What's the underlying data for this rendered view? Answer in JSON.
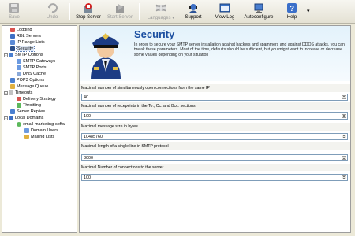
{
  "toolbar": {
    "buttons": [
      {
        "label": "Save",
        "icon": "save-icon",
        "enabled": false
      },
      {
        "label": "Undo",
        "icon": "undo-icon",
        "enabled": false
      },
      {
        "label": "Stop Server",
        "icon": "stop-server-icon",
        "enabled": true
      },
      {
        "label": "Start Server",
        "icon": "start-server-icon",
        "enabled": false
      },
      {
        "label": "Languages",
        "icon": "flag-icon",
        "enabled": false
      },
      {
        "label": "Support",
        "icon": "support-icon",
        "enabled": true
      },
      {
        "label": "View Log",
        "icon": "view-log-icon",
        "enabled": true
      },
      {
        "label": "Autoconfigure",
        "icon": "autoconfigure-icon",
        "enabled": true
      },
      {
        "label": "Help",
        "icon": "help-icon",
        "enabled": true
      }
    ]
  },
  "tree": {
    "items": [
      {
        "label": "Logging",
        "level": 1
      },
      {
        "label": "RBL Servers",
        "level": 1
      },
      {
        "label": "IP Range Lists",
        "level": 1
      },
      {
        "label": "Security",
        "level": 1,
        "selected": true
      },
      {
        "label": "SMTP Options",
        "level": 0
      },
      {
        "label": "SMTP Gateways",
        "level": 2
      },
      {
        "label": "SMTP Ports",
        "level": 2
      },
      {
        "label": "DNS Cache",
        "level": 2
      },
      {
        "label": "POP3 Options",
        "level": 1
      },
      {
        "label": "Message Queue",
        "level": 1
      },
      {
        "label": "Timeouts",
        "level": 0
      },
      {
        "label": "Delivery Strategy",
        "level": 2
      },
      {
        "label": "Throttling",
        "level": 2
      },
      {
        "label": "Server Replies",
        "level": 1
      },
      {
        "label": "Local Domains",
        "level": 0
      },
      {
        "label": "email-marketing-softw",
        "level": 2
      },
      {
        "label": "Domain Users",
        "level": 3
      },
      {
        "label": "Mailing Lists",
        "level": 3
      }
    ]
  },
  "header": {
    "title": "Security",
    "description": "In order to secure your SMTP server installation against hackers and spammers and against DDOS attacks, you can tweak these parameters. Most of the time, defaults should be sufficient, but you might want to increase or decrease some values depending on your situation"
  },
  "fields": [
    {
      "label": "Maximal number of simultaneously open connections from the same IP",
      "value": "40"
    },
    {
      "label": "Maximal number of recepeints in the To:, Cc: and Bcc: sections",
      "value": "100"
    },
    {
      "label": "Maximal message size in bytes",
      "value": "10485760"
    },
    {
      "label": "Maximal length of a single line in SMTP protocol",
      "value": "3000"
    },
    {
      "label": "Maximal Number of connections to the server",
      "value": "100"
    }
  ],
  "colors": {
    "title": "#1b4ea0",
    "header_bg": "#e3f2fb",
    "stop": "#d32020"
  }
}
